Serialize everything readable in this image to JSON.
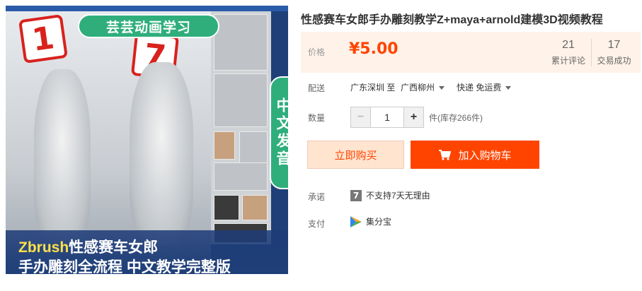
{
  "gallery": {
    "top_banner": "芸芸动画学习",
    "sign_left": "1",
    "sign_right": "7",
    "side_banner": "中文发音",
    "bottom_line1_highlight": "Zbrush",
    "bottom_line1_rest": "性感赛车女郎",
    "bottom_line2": "手办雕刻全流程 中文教学完整版"
  },
  "product": {
    "title": "性感赛车女郎手办雕刻教学Z+maya+arnold建模3D视频教程"
  },
  "price": {
    "label": "价格",
    "value": "¥5.00",
    "reviews_count": "21",
    "reviews_label": "累计评论",
    "sales_count": "17",
    "sales_label": "交易成功"
  },
  "delivery": {
    "label": "配送",
    "from": "广东深圳 至",
    "to": "广西柳州",
    "method": "快递 免运费"
  },
  "quantity": {
    "label": "数量",
    "minus": "−",
    "value": "1",
    "plus": "+",
    "stock": "件(库存266件)"
  },
  "actions": {
    "buy_now": "立即购买",
    "add_to_cart": "加入购物车"
  },
  "promise": {
    "label": "承诺",
    "icon_text": "7",
    "text": "不支持7天无理由"
  },
  "payment": {
    "label": "支付",
    "method": "集分宝"
  },
  "colors": {
    "accent": "#ff4400",
    "price_bg": "#fff2e8",
    "banner_green": "#2fae7c"
  }
}
